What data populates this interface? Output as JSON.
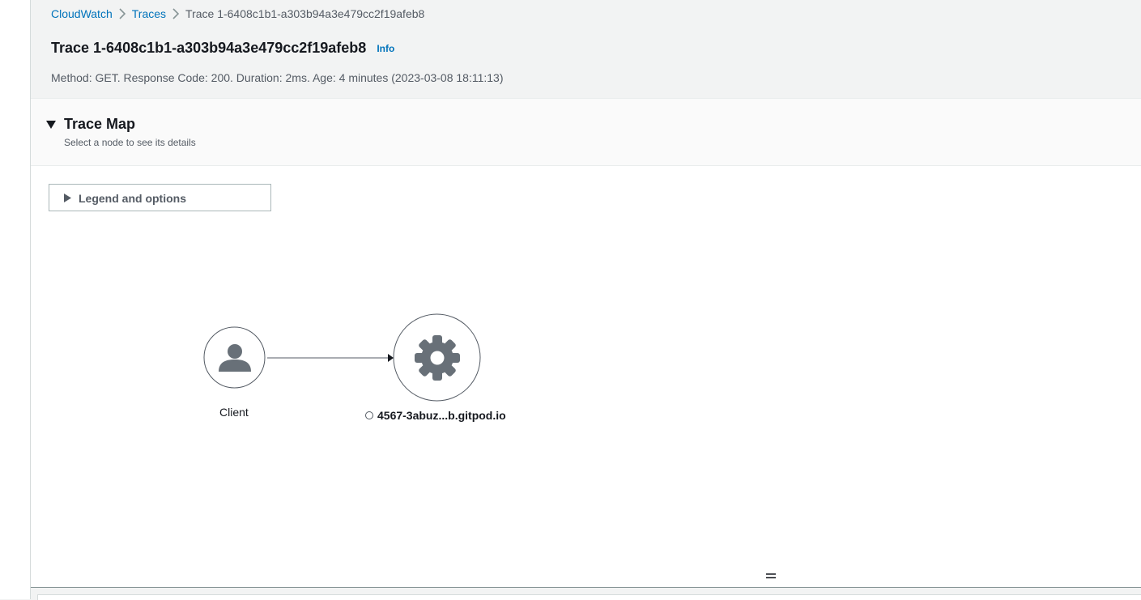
{
  "breadcrumb": {
    "items": [
      "CloudWatch",
      "Traces"
    ],
    "current": "Trace 1-6408c1b1-a303b94a3e479cc2f19afeb8"
  },
  "header": {
    "title": "Trace 1-6408c1b1-a303b94a3e479cc2f19afeb8",
    "info_label": "Info",
    "summary": "Method: GET. Response Code: 200. Duration: 2ms. Age: 4 minutes (2023-03-08 18:11:13)"
  },
  "trace_map": {
    "title": "Trace Map",
    "description": "Select a node to see its details",
    "legend_label": "Legend and options",
    "nodes": {
      "client": {
        "label": "Client",
        "icon": "user-icon"
      },
      "service": {
        "label": "4567-3abuz...b.gitpod.io",
        "icon": "gear-icon"
      }
    }
  },
  "colors": {
    "link": "#0073bb",
    "node_icon": "#687078",
    "node_border": "#545b64"
  }
}
